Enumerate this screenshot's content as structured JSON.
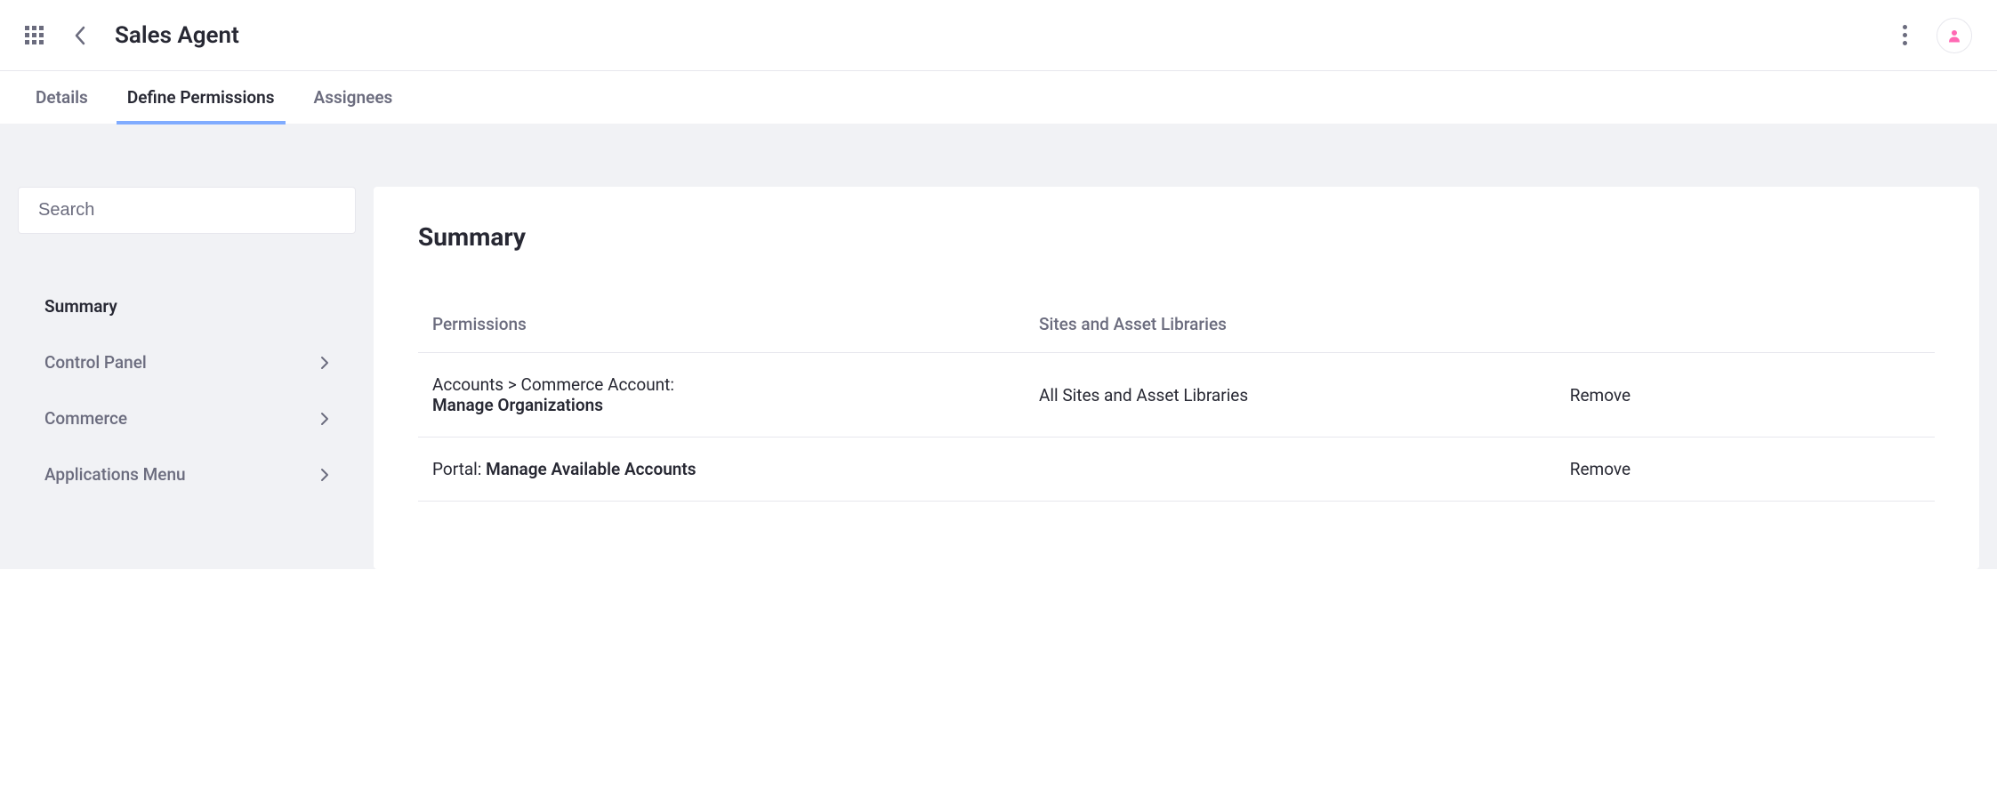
{
  "header": {
    "title": "Sales Agent"
  },
  "tabs": [
    {
      "label": "Details",
      "active": false
    },
    {
      "label": "Define Permissions",
      "active": true
    },
    {
      "label": "Assignees",
      "active": false
    }
  ],
  "sidebar": {
    "search_placeholder": "Search",
    "items": [
      {
        "label": "Summary",
        "expandable": false,
        "strong": true
      },
      {
        "label": "Control Panel",
        "expandable": true,
        "strong": false
      },
      {
        "label": "Commerce",
        "expandable": true,
        "strong": false
      },
      {
        "label": "Applications Menu",
        "expandable": true,
        "strong": false
      }
    ]
  },
  "panel": {
    "title": "Summary",
    "columns": {
      "permissions": "Permissions",
      "scope": "Sites and Asset Libraries"
    },
    "rows": [
      {
        "perm_prefix": "Accounts > Commerce Account: ",
        "perm_bold": "Manage Organizations",
        "scope": "All Sites and Asset Libraries",
        "action": "Remove"
      },
      {
        "perm_prefix": "Portal: ",
        "perm_bold": "Manage Available Accounts",
        "scope": "",
        "action": "Remove"
      }
    ]
  }
}
